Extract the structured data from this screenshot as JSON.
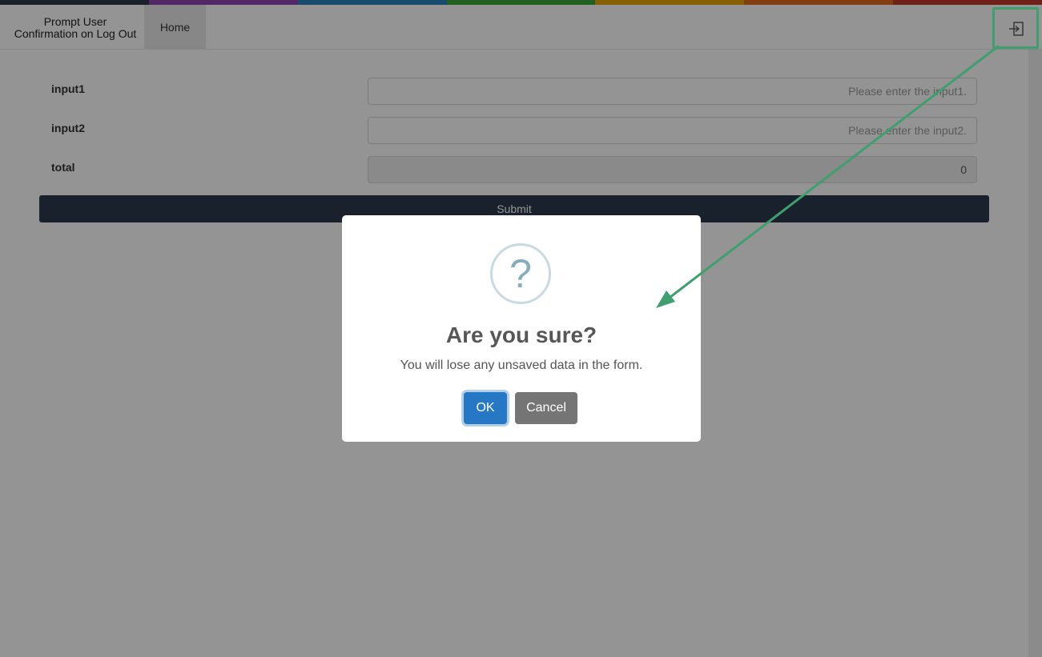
{
  "theme": {
    "strip_colors": [
      "#2b3a4a",
      "#8e44ad",
      "#2980b9",
      "#3aa53a",
      "#e8a50c",
      "#e06a1e",
      "#c0392b"
    ],
    "accent_highlight": "#3f9f6e"
  },
  "navbar": {
    "brand": "Prompt User Confirmation on Log Out",
    "home_tab": "Home",
    "logout_icon": "logout-icon"
  },
  "form": {
    "rows": [
      {
        "label": "input1",
        "placeholder": "Please enter the input1.",
        "value": ""
      },
      {
        "label": "input2",
        "placeholder": "Please enter the input2.",
        "value": ""
      },
      {
        "label": "total",
        "placeholder": "",
        "value": "0"
      }
    ],
    "submit_label": "Submit"
  },
  "dialog": {
    "icon": "question-icon",
    "icon_glyph": "?",
    "title": "Are you sure?",
    "text": "You will lose any unsaved data in the form.",
    "ok_label": "OK",
    "cancel_label": "Cancel"
  }
}
